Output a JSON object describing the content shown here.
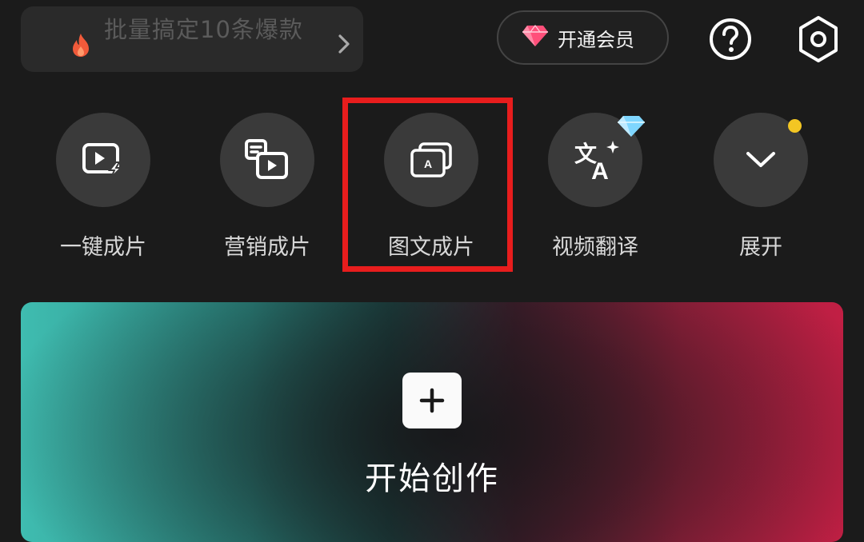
{
  "promo": {
    "text": "批量搞定10条爆款",
    "icon": "fire-icon"
  },
  "vip": {
    "label": "开通会员",
    "icon": "diamond-icon"
  },
  "top_icons": [
    "help-icon",
    "settings-icon"
  ],
  "tools": [
    {
      "label": "一键成片",
      "icon": "one-click-video-icon"
    },
    {
      "label": "营销成片",
      "icon": "marketing-video-icon"
    },
    {
      "label": "图文成片",
      "icon": "image-text-video-icon"
    },
    {
      "label": "视频翻译",
      "icon": "translate-icon",
      "badge": "diamond-badge-icon"
    },
    {
      "label": "展开",
      "icon": "chevron-down-icon",
      "badge": "yellow-dot"
    }
  ],
  "create": {
    "label": "开始创作",
    "icon": "plus-icon"
  },
  "colors": {
    "background": "#1b1b1b",
    "highlight": "#e81d1d",
    "gradient_left": "#3fbcb0",
    "gradient_right": "#c21f44",
    "dot": "#f3c623"
  }
}
